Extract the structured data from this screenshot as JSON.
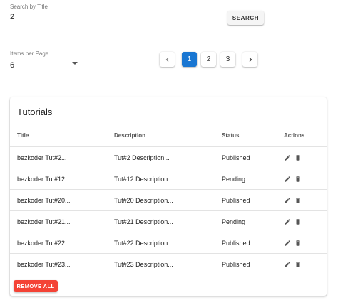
{
  "search": {
    "label": "Search by Title",
    "value": "2",
    "button_label": "SEARCH"
  },
  "items_per_page": {
    "label": "Items per Page",
    "value": "6"
  },
  "pagination": {
    "prev_icon": "chevron-left-icon",
    "next_icon": "chevron-right-icon",
    "pages": [
      "1",
      "2",
      "3"
    ],
    "current": "1",
    "active_color": "#1976d2"
  },
  "tutorials": {
    "title": "Tutorials",
    "columns": {
      "title": "Title",
      "description": "Description",
      "status": "Status",
      "actions": "Actions"
    },
    "rows": [
      {
        "title": "bezkoder Tut#2...",
        "description": "Tut#2 Description...",
        "status": "Published"
      },
      {
        "title": "bezkoder Tut#12...",
        "description": "Tut#12 Description...",
        "status": "Pending"
      },
      {
        "title": "bezkoder Tut#20...",
        "description": "Tut#20 Description...",
        "status": "Published"
      },
      {
        "title": "bezkoder Tut#21...",
        "description": "Tut#21 Description...",
        "status": "Pending"
      },
      {
        "title": "bezkoder Tut#22...",
        "description": "Tut#22 Description...",
        "status": "Published"
      },
      {
        "title": "bezkoder Tut#23...",
        "description": "Tut#23 Description...",
        "status": "Published"
      }
    ],
    "row_action_icons": [
      "pencil-icon",
      "trash-icon"
    ],
    "remove_all_label": "REMOVE ALL",
    "remove_all_color": "#f44336"
  }
}
